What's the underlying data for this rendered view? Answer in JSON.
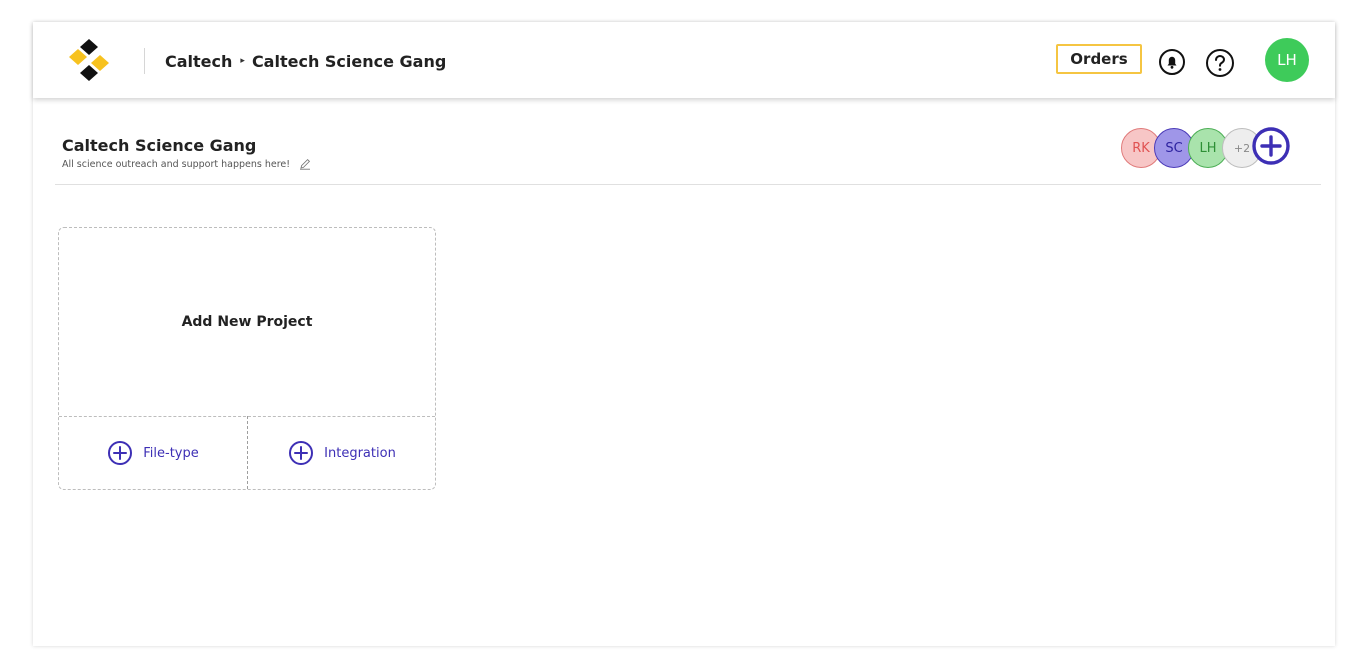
{
  "header": {
    "breadcrumb_root": "Caltech",
    "breadcrumb_separator": "▸",
    "breadcrumb_current": "Caltech Science Gang",
    "orders_label": "Orders",
    "user_initials": "LH"
  },
  "team": {
    "name": "Caltech Science Gang",
    "description": "All science outreach and support happens here!",
    "members": [
      {
        "initials": "RK"
      },
      {
        "initials": "SC"
      },
      {
        "initials": "LH"
      }
    ],
    "more_members": "+2"
  },
  "project_card": {
    "title": "Add New Project",
    "file_type_label": "File-type",
    "integration_label": "Integration"
  },
  "colors": {
    "accent": "#3d2fb5",
    "orders_border": "#f5c542",
    "user_avatar": "#3ecb5a",
    "logo_yellow": "#f7c21f"
  },
  "icons": {
    "logo": "brand-logo-icon",
    "notifications": "bell-icon",
    "help": "help-icon",
    "edit": "pencil-icon",
    "add": "plus-circle-icon"
  }
}
